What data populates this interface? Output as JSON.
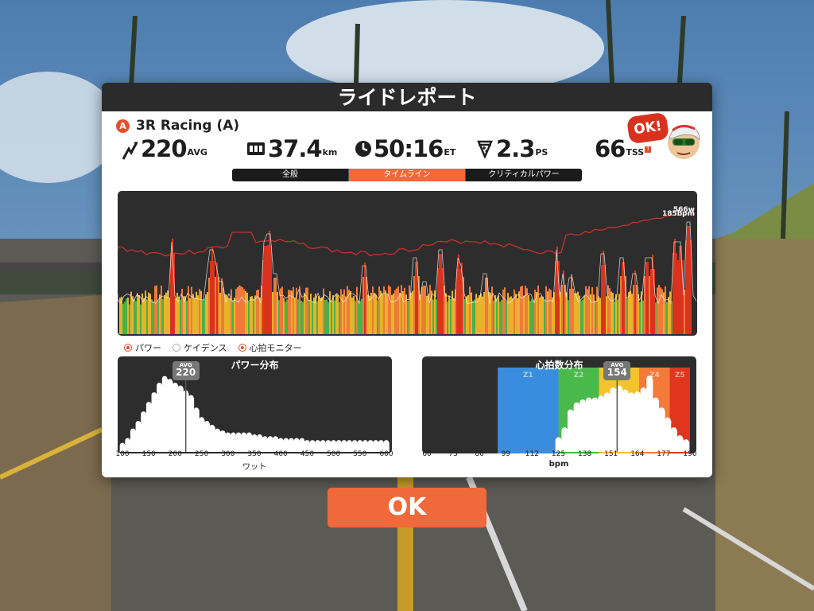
{
  "modal": {
    "title": "ライドレポート",
    "team_badge": "A",
    "team_name": "3R Racing (A)"
  },
  "stats": {
    "power": {
      "icon": "lightning-icon",
      "value": "220",
      "unit": "AVG"
    },
    "distance": {
      "icon": "odometer-icon",
      "value": "37.4",
      "unit": "km"
    },
    "time": {
      "icon": "clock-icon",
      "value": "50:16",
      "unit": "ET"
    },
    "pizza": {
      "icon": "pizza-icon",
      "value": "2.3",
      "unit": "PS"
    },
    "tss": {
      "value": "66",
      "unit": "TSS"
    }
  },
  "avatar": {
    "speech": "OK!"
  },
  "tabs": [
    {
      "label": "全般",
      "active": false
    },
    {
      "label": "タイムライン",
      "active": true
    },
    {
      "label": "クリティカルパワー",
      "active": false
    }
  ],
  "timeline": {
    "marker_label_1": "566w",
    "marker_label_2": "185bpm"
  },
  "legend": [
    {
      "label": "パワー",
      "checked": true
    },
    {
      "label": "ケイデンス",
      "checked": false
    },
    {
      "label": "心拍モニター",
      "checked": true
    }
  ],
  "power_hist": {
    "title": "パワー分布",
    "xlabel": "ワット",
    "avg_label": "AVG",
    "avg_value": "220",
    "ticks": [
      "100",
      "150",
      "200",
      "250",
      "300",
      "350",
      "400",
      "450",
      "500",
      "550",
      "600"
    ]
  },
  "hr_hist": {
    "title": "心拍数分布",
    "xlabel": "bpm",
    "avg_label": "AVG",
    "avg_value": "154",
    "ticks": [
      "60",
      "73",
      "86",
      "99",
      "112",
      "125",
      "138",
      "151",
      "164",
      "177",
      "190"
    ],
    "zones": [
      {
        "label": "Z1",
        "color": "#3a8dde"
      },
      {
        "label": "Z2",
        "color": "#49b94b"
      },
      {
        "label": "Z3",
        "color": "#f2c32c"
      },
      {
        "label": "Z4",
        "color": "#f57a3a"
      },
      {
        "label": "Z5",
        "color": "#e0361f"
      }
    ]
  },
  "ok_button": "OK",
  "chart_data": [
    {
      "type": "bar",
      "title": "パワー分布",
      "xlabel": "ワット",
      "categories": [
        100,
        110,
        120,
        130,
        140,
        150,
        160,
        170,
        180,
        190,
        200,
        210,
        220,
        230,
        240,
        250,
        260,
        270,
        280,
        290,
        300,
        310,
        320,
        330,
        340,
        350,
        360,
        370,
        380,
        390,
        400,
        410,
        420,
        430,
        440,
        450,
        460,
        470,
        480,
        490,
        500,
        510,
        520,
        530,
        540,
        550,
        560,
        570,
        580,
        590,
        600
      ],
      "values": [
        5,
        10,
        20,
        28,
        38,
        48,
        58,
        68,
        75,
        72,
        68,
        65,
        60,
        55,
        42,
        32,
        28,
        24,
        20,
        18,
        16,
        16,
        16,
        16,
        16,
        14,
        14,
        12,
        12,
        12,
        10,
        10,
        10,
        10,
        10,
        8,
        8,
        8,
        8,
        8,
        8,
        8,
        8,
        8,
        8,
        8,
        8,
        8,
        8,
        8,
        8
      ],
      "xlim": [
        100,
        600
      ],
      "avg": 220
    },
    {
      "type": "bar",
      "title": "心拍数分布",
      "xlabel": "bpm",
      "categories": [
        125,
        128,
        131,
        134,
        137,
        140,
        143,
        146,
        149,
        152,
        155,
        158,
        161,
        164,
        167,
        170,
        173,
        176,
        179,
        182,
        185,
        188
      ],
      "values": [
        10,
        20,
        38,
        45,
        48,
        50,
        50,
        52,
        55,
        60,
        62,
        58,
        55,
        56,
        60,
        72,
        50,
        40,
        30,
        20,
        12,
        8
      ],
      "xlim": [
        60,
        190
      ],
      "avg": 154
    }
  ]
}
